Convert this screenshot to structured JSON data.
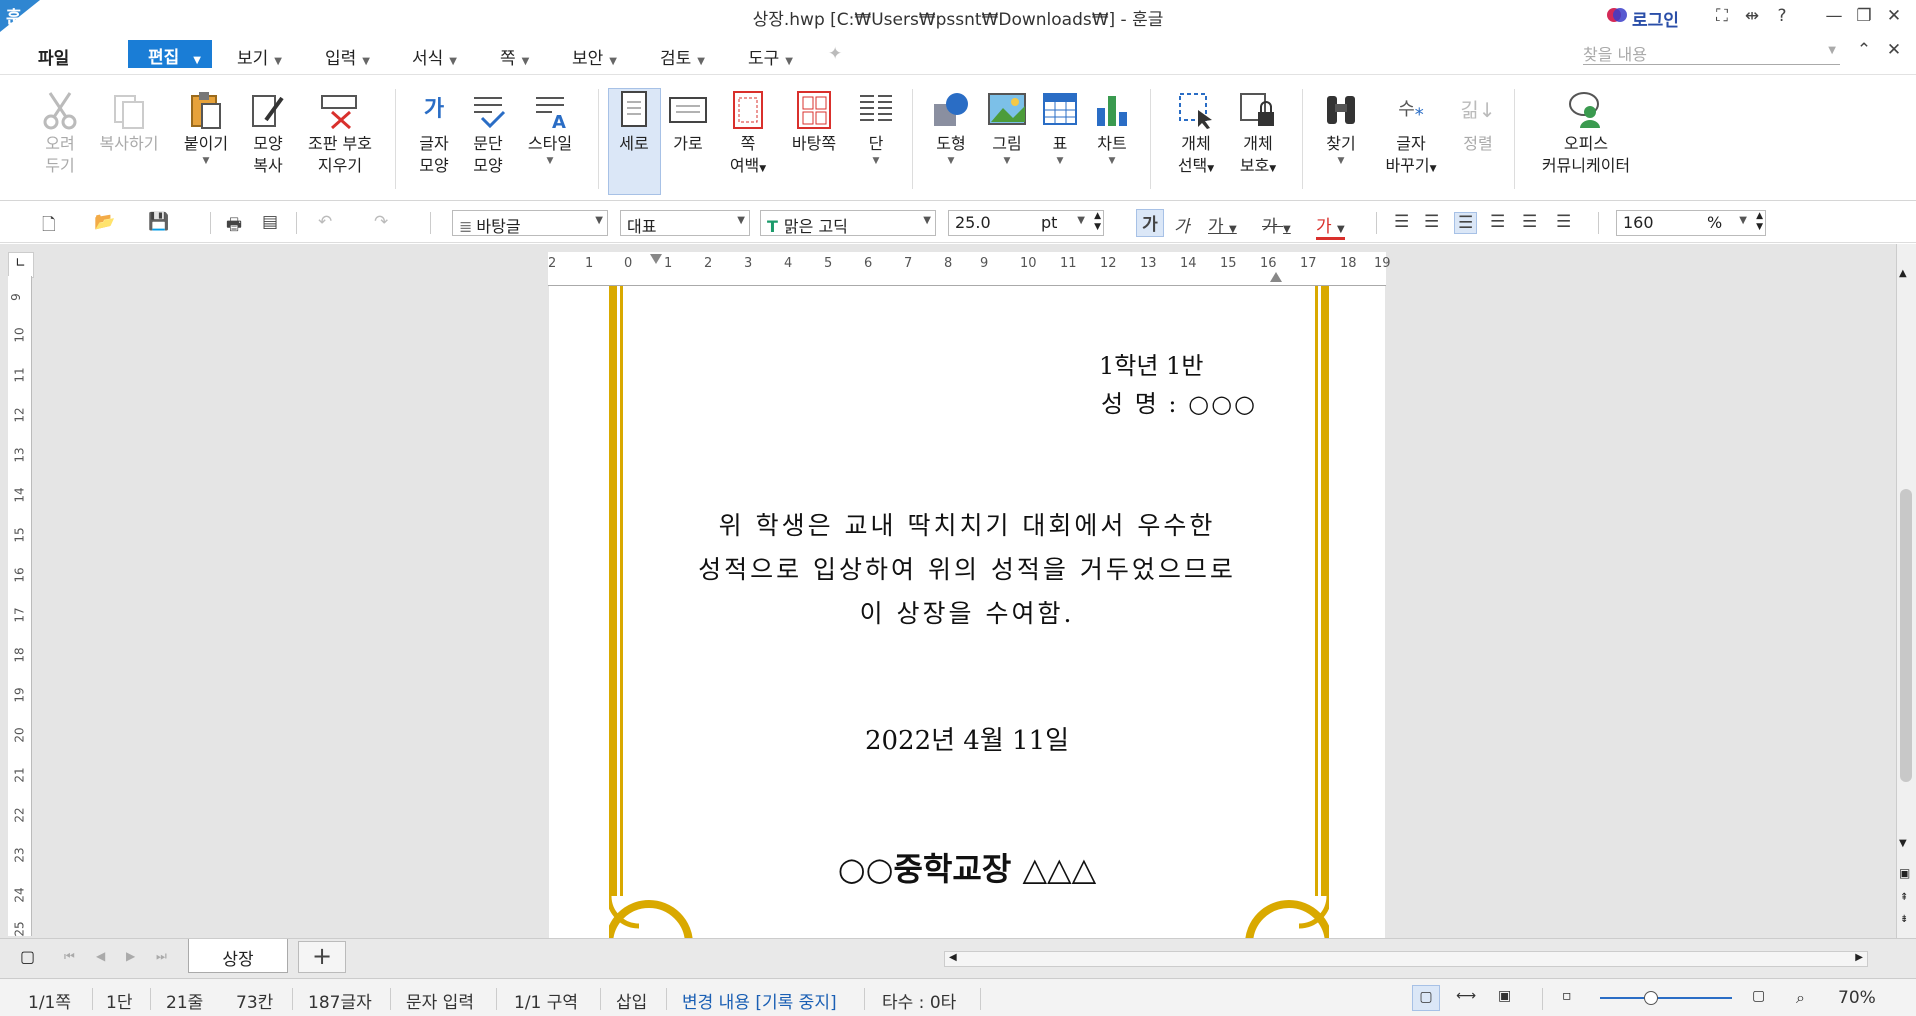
{
  "window": {
    "app_logo": "훈",
    "title": "상장.hwp [C:₩Users₩pssnt₩Downloads₩] - 훈글",
    "login": "로그인",
    "controls": {
      "fullscreen": "⛶",
      "split": "⇹",
      "help": "?",
      "minimize": "—",
      "restore": "❐",
      "close": "✕"
    }
  },
  "menu": {
    "file": "파일",
    "edit": "편집",
    "items": [
      "보기",
      "입력",
      "서식",
      "쪽",
      "보안",
      "검토",
      "도구"
    ],
    "search_placeholder": "찾을 내용"
  },
  "ribbon": {
    "cut": [
      "오려",
      "두기"
    ],
    "copy": "복사하기",
    "paste": "붙이기",
    "format_copy": [
      "모양",
      "복사"
    ],
    "clear_marks": [
      "조판 부호",
      "지우기"
    ],
    "char_shape": [
      "글자",
      "모양"
    ],
    "para_shape": [
      "문단",
      "모양"
    ],
    "style": "스타일",
    "portrait": "세로",
    "landscape": "가로",
    "page_margin": [
      "쪽",
      "여백"
    ],
    "master_page": "바탕쪽",
    "columns": "단",
    "shapes": "도형",
    "picture": "그림",
    "table": "표",
    "chart": "차트",
    "obj_select": [
      "개체",
      "선택"
    ],
    "obj_protect": [
      "개체",
      "보호"
    ],
    "find": "찾기",
    "replace": [
      "글자",
      "바꾸기"
    ],
    "sort": "정렬",
    "office_communicator": [
      "오피스",
      "커뮤니케이터"
    ]
  },
  "format": {
    "style": "바탕글",
    "lang": "대표",
    "font": "맑은 고딕",
    "size": "25.0",
    "unit": "pt",
    "zoom": "160",
    "zoom_unit": "%"
  },
  "ruler": {
    "h_ticks": [
      "2",
      "1",
      "0",
      "1",
      "2",
      "3",
      "4",
      "5",
      "6",
      "7",
      "8",
      "9",
      "10",
      "11",
      "12",
      "13",
      "14",
      "15",
      "16",
      "17",
      "18",
      "19"
    ],
    "v_ticks": [
      "9",
      "10",
      "11",
      "12",
      "13",
      "14",
      "15",
      "16",
      "17",
      "18",
      "19",
      "20",
      "21",
      "22",
      "23",
      "24",
      "25"
    ]
  },
  "document": {
    "class_line": "1학년 1반",
    "name_line": "성 명 : ○○○",
    "body_line1": "위 학생은 교내 딱치치기 대회에서 우수한",
    "body_line2": "성적으로 입상하여 위의 성적을 거두었으므로",
    "body_line3": "이 상장을 수여함.",
    "date": "2022년 4월 11일",
    "signature": "○○중학교장 △△△"
  },
  "colors": {
    "accent": "#1a7dd6",
    "border_gold": "#d9a900"
  },
  "tabs": {
    "sheet": "상장",
    "add": "+"
  },
  "status": {
    "page": "1/1쪽",
    "column": "1단",
    "line": "21줄",
    "col": "73칸",
    "chars": "187글자",
    "mode": "문자 입력",
    "section": "1/1 구역",
    "insert": "삽입",
    "track": "변경 내용 [기록 중지]",
    "keystroke": "타수 : 0타",
    "zoom": "70%"
  }
}
